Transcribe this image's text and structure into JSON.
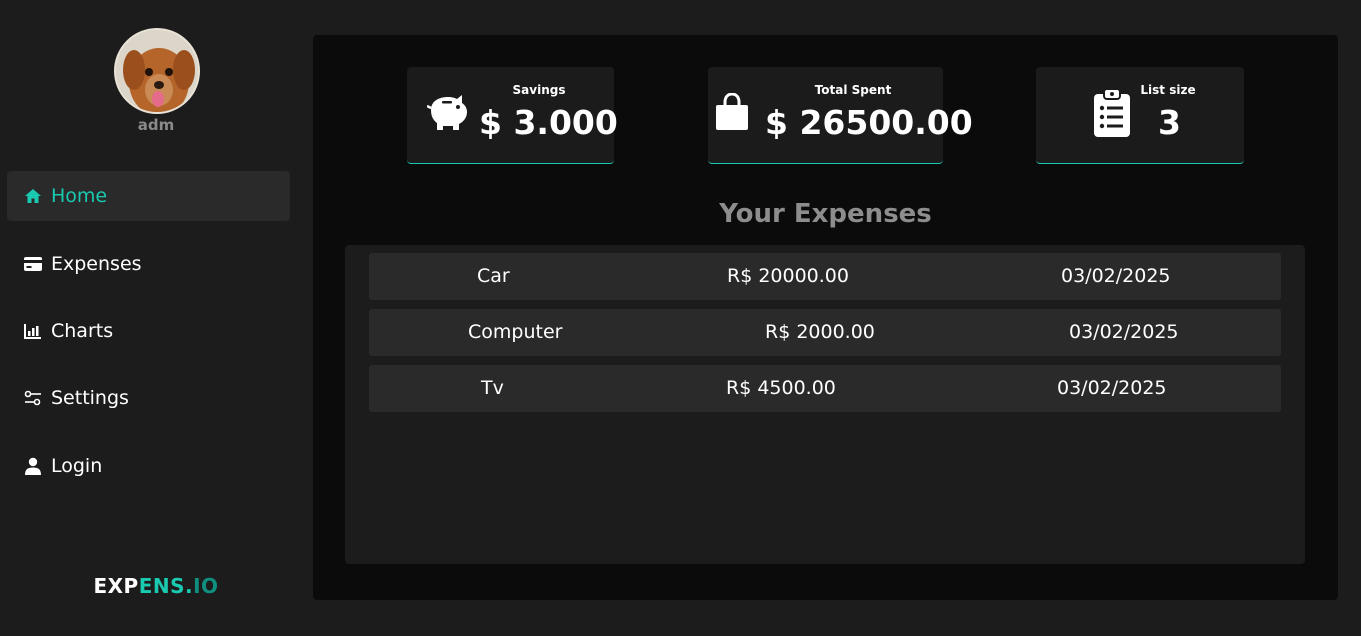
{
  "user": {
    "name": "adm"
  },
  "nav": {
    "items": [
      {
        "label": "Home",
        "icon": "home-icon",
        "active": true
      },
      {
        "label": "Expenses",
        "icon": "credit-card-icon"
      },
      {
        "label": "Charts",
        "icon": "bar-chart-icon"
      },
      {
        "label": "Settings",
        "icon": "sliders-icon"
      },
      {
        "label": "Login",
        "icon": "user-icon"
      }
    ]
  },
  "brand": {
    "part1": "EXP",
    "part2": "ENS.",
    "part3": "IO"
  },
  "cards": [
    {
      "title": "Savings",
      "value": "$ 3.000",
      "icon": "piggy-bank-icon"
    },
    {
      "title": "Total Spent",
      "value": "$ 26500.00",
      "icon": "shopping-bag-icon"
    },
    {
      "title": "List size",
      "value": "3",
      "icon": "clipboard-list-icon"
    }
  ],
  "expenses": {
    "title": "Your Expenses",
    "rows": [
      {
        "name": "Car",
        "amount": "R$ 20000.00",
        "date": "03/02/2025"
      },
      {
        "name": "Computer",
        "amount": "R$ 2000.00",
        "date": "03/02/2025"
      },
      {
        "name": "Tv",
        "amount": "R$ 4500.00",
        "date": "03/02/2025"
      }
    ]
  },
  "colors": {
    "accent": "#19c9b0",
    "background": "#1c1c1c",
    "panel": "#0b0b0b",
    "row": "#2a2a2a"
  }
}
